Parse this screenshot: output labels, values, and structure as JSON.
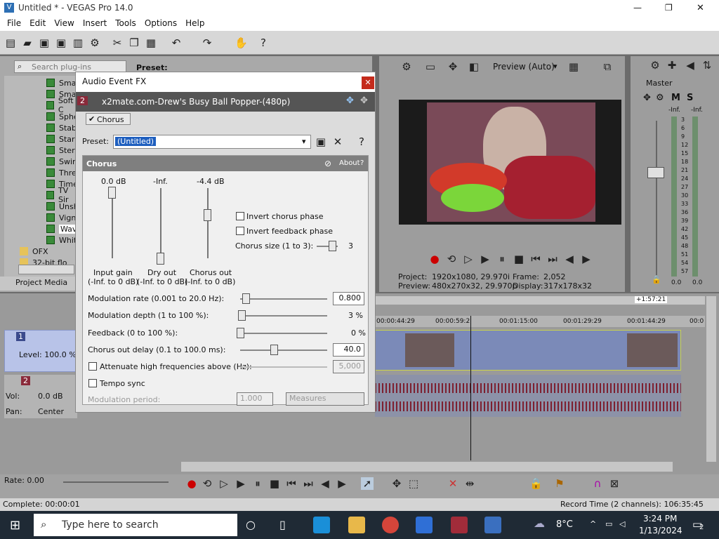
{
  "window": {
    "title": "Untitled * - VEGAS Pro 14.0",
    "minimize": "—",
    "restore": "❐",
    "close": "✕"
  },
  "menu": [
    "File",
    "Edit",
    "View",
    "Insert",
    "Tools",
    "Options",
    "Help"
  ],
  "plugins": {
    "search_placeholder": "Search plug-ins",
    "preset_label": "Preset:",
    "items": [
      "Smart",
      "Smart",
      "Soft C",
      "Spher",
      "Stabil",
      "Starb",
      "Stere",
      "Swirl",
      "Thres",
      "Timec",
      "TV Sir",
      "Unsha",
      "Vigne",
      "Wave",
      "White"
    ],
    "folders": [
      "OFX",
      "32-bit flo"
    ],
    "tab": "Project Media"
  },
  "preview": {
    "mode": "Preview (Auto)",
    "project_label": "Project:",
    "project_value": "1920x1080, 29.970i",
    "preview_label": "Preview:",
    "preview_value": "480x270x32, 29.970p",
    "frame_label": "Frame:",
    "frame_value": "2,052",
    "display_label": "Display:",
    "display_value": "317x178x32"
  },
  "master": {
    "title": "Master",
    "m": "M",
    "s": "S",
    "left_inf": "-Inf.",
    "right_inf": "-Inf.",
    "scale": [
      "3",
      "6",
      "9",
      "12",
      "15",
      "18",
      "21",
      "24",
      "27",
      "30",
      "33",
      "36",
      "39",
      "42",
      "45",
      "48",
      "51",
      "54",
      "57"
    ],
    "left_val": "0.0",
    "right_val": "0.0"
  },
  "dialog": {
    "title": "Audio Event FX",
    "track_num": "2",
    "media_name": "x2mate.com-Drew's Busy Ball Popper-(480p)",
    "chain_item": "Chorus",
    "preset_label": "Preset:",
    "preset_value": "(Untitled)",
    "help": "?"
  },
  "chorus": {
    "title": "Chorus",
    "about": "About",
    "about_q": "?",
    "input_gain_val": "0.0 dB",
    "dry_out_val": "-Inf.",
    "chorus_out_val": "-4.4 dB",
    "input_gain_lbl": "Input gain",
    "input_gain_range": "(-Inf. to 0 dB)",
    "dry_out_lbl": "Dry out",
    "dry_out_range": "(-Inf. to 0 dB)",
    "chorus_out_lbl": "Chorus out",
    "chorus_out_range": "(-Inf. to 0 dB)",
    "invert_chorus": "Invert chorus phase",
    "invert_feedback": "Invert feedback phase",
    "chorus_size_lbl": "Chorus size (1 to 3):",
    "chorus_size_val": "3",
    "mod_rate_lbl": "Modulation rate (0.001 to 20.0 Hz):",
    "mod_rate_val": "0.800",
    "mod_depth_lbl": "Modulation depth (1 to 100 %):",
    "mod_depth_val": "3 %",
    "feedback_lbl": "Feedback (0 to 100 %):",
    "feedback_val": "0 %",
    "delay_lbl": "Chorus out delay (0.1 to 100.0 ms):",
    "delay_val": "40.0",
    "attenuate_lbl": "Attenuate high frequencies above (Hz):",
    "attenuate_val": "5,000",
    "tempo_sync": "Tempo sync",
    "mod_period_lbl": "Modulation period:",
    "mod_period_val": "1.000",
    "measures": "Measures"
  },
  "timeline": {
    "end_marker": "+1:57:21",
    "times": [
      "00:00:44:29",
      "00:00:59:2",
      "00:01:15:00",
      "00:01:29:29",
      "00:01:44:29",
      "00:0"
    ]
  },
  "tracks": {
    "t1_num": "1",
    "t1_level": "Level: 100.0 %",
    "t2_num": "2",
    "t2_vol": "Vol:",
    "t2_vol_val": "0.0 dB",
    "t2_pan": "Pan:",
    "t2_pan_val": "Center"
  },
  "bottom": {
    "rate": "Rate: 0.00",
    "complete": "Complete: 00:00:01",
    "record_time": "Record Time (2 channels): 106:35:45"
  },
  "taskbar": {
    "search": "Type here to search",
    "temp": "8°C",
    "time": "3:24 PM",
    "date": "1/13/2024",
    "notif": "2"
  }
}
